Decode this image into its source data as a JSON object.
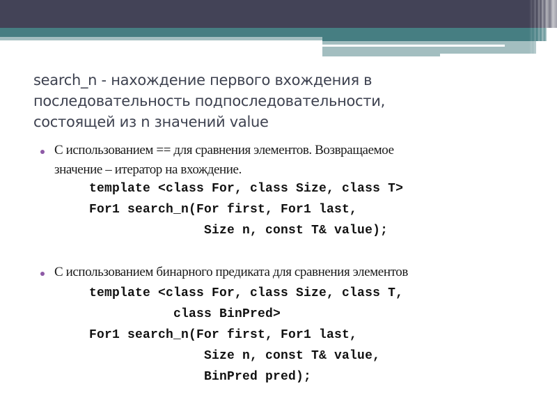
{
  "slide": {
    "title_lines": [
      "search_n - нахождение первого вхождения в",
      "последовательность подпоследовательности,",
      "состоящей из n значений value"
    ],
    "bullets": [
      {
        "text_lines": [
          "С использованием == для сравнения элементов. Возвращаемое",
          "значение – итератор на вхождение."
        ],
        "code_lines": [
          "template <class For, class Size, class T>",
          "For1 search_n(For first, For1 last,",
          "               Size n, const T& value);"
        ]
      },
      {
        "text_lines": [
          "С использованием бинарного предиката для сравнения элементов"
        ],
        "code_lines": [
          "template <class For, class Size, class T,",
          "           class BinPred>",
          "For1 search_n(For first, For1 last,",
          "               Size n, const T& value,",
          "               BinPred pred);"
        ]
      }
    ],
    "colors": {
      "header_dark": "#434357",
      "header_teal": "#467e82",
      "header_light": "#a3bec0",
      "bullet": "#8e5aa6",
      "title_text": "#3e4250"
    }
  }
}
